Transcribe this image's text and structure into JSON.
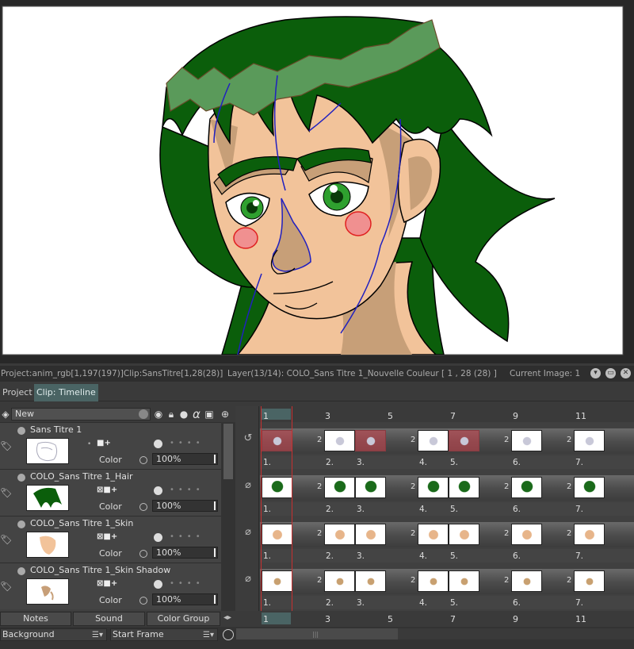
{
  "status": {
    "project": "Project:anim_rgb[1,197(197)]Clip:SansTitre[1,28(28)]",
    "layer": "Layer(13/14): COLO_Sans Titre 1_Nouvelle Couleur [ 1 , 28  (28) ]",
    "current_image": "Current Image: 1"
  },
  "tabs": [
    {
      "label": "Project",
      "active": false
    },
    {
      "label": "Clip: Timeline",
      "active": true
    }
  ],
  "layer_toolbar": {
    "new_label": "New",
    "alpha_icon": "α"
  },
  "layers": [
    {
      "name": "Sans Titre 1",
      "color_label": "Color",
      "opacity": "100%",
      "thumb": "sketch"
    },
    {
      "name": "COLO_Sans Titre 1_Hair",
      "color_label": "Color",
      "opacity": "100%",
      "thumb": "hair"
    },
    {
      "name": "COLO_Sans Titre 1_Skin",
      "color_label": "Color",
      "opacity": "100%",
      "thumb": "skin"
    },
    {
      "name": "COLO_Sans Titre 1_Skin Shadow",
      "color_label": "Color",
      "opacity": "100%",
      "thumb": "shadow"
    }
  ],
  "ruler": {
    "frames": [
      "1",
      "3",
      "5",
      "7",
      "9",
      "11"
    ],
    "current": "1"
  },
  "frame_labels": [
    "1.",
    "2.",
    "3.",
    "4.",
    "5.",
    "6.",
    "7."
  ],
  "exposure": "2",
  "bottom_buttons": {
    "notes": "Notes",
    "sound": "Sound",
    "color_group": "Color Group"
  },
  "bottom_selects": {
    "background": "Background",
    "start_frame": "Start Frame"
  },
  "colors": {
    "hair": "#0b5e0b",
    "hair_highlight": "#5a9a5a",
    "skin": "#f2c39a",
    "skin_shadow": "#c79f78",
    "cheek": "#f09090",
    "accent_tab": "#4a6464",
    "playhead": "#c83030"
  }
}
